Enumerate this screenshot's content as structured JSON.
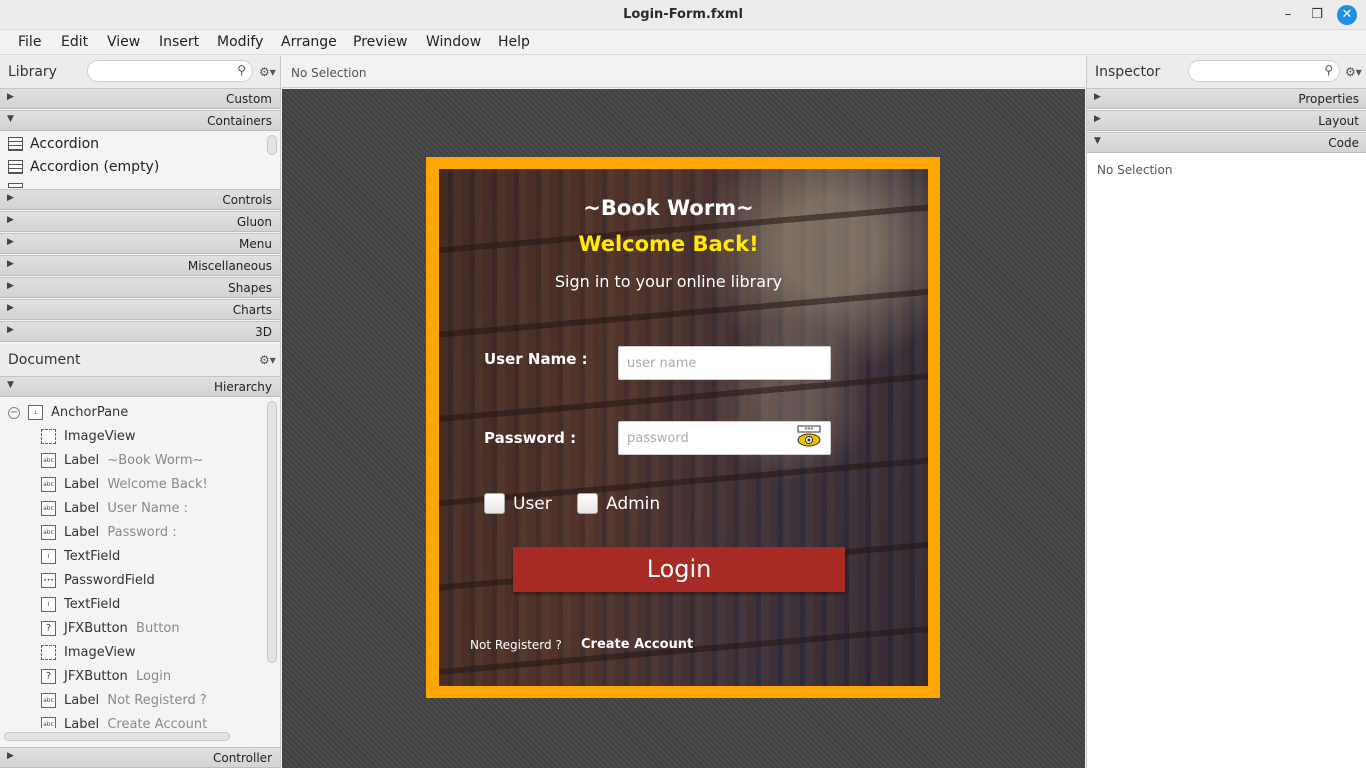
{
  "window": {
    "title": "Login-Form.fxml"
  },
  "menu": [
    "File",
    "Edit",
    "View",
    "Insert",
    "Modify",
    "Arrange",
    "Preview",
    "Window",
    "Help"
  ],
  "library": {
    "title": "Library",
    "sections_top": [
      "Custom",
      "Containers"
    ],
    "containers_items": [
      "Accordion",
      "Accordion  (empty)"
    ],
    "sections_bottom": [
      "Controls",
      "Gluon",
      "Menu",
      "Miscellaneous",
      "Shapes",
      "Charts",
      "3D"
    ]
  },
  "document": {
    "title": "Document",
    "hierarchy_label": "Hierarchy",
    "controller_label": "Controller",
    "tree": [
      {
        "type": "AnchorPane",
        "detail": "",
        "icon": "anchor-icon"
      },
      {
        "type": "ImageView",
        "detail": "",
        "icon": "imageview-icon"
      },
      {
        "type": "Label",
        "detail": "~Book Worm~",
        "icon": "label-icon"
      },
      {
        "type": "Label",
        "detail": "Welcome Back!",
        "icon": "label-icon"
      },
      {
        "type": "Label",
        "detail": "User Name  :",
        "icon": "label-icon"
      },
      {
        "type": "Label",
        "detail": "Password    :",
        "icon": "label-icon"
      },
      {
        "type": "TextField",
        "detail": "",
        "icon": "textfield-icon"
      },
      {
        "type": "PasswordField",
        "detail": "",
        "icon": "passwordfield-icon"
      },
      {
        "type": "TextField",
        "detail": "",
        "icon": "textfield-icon"
      },
      {
        "type": "JFXButton",
        "detail": "Button",
        "icon": "button-icon"
      },
      {
        "type": "ImageView",
        "detail": "",
        "icon": "imageview-icon"
      },
      {
        "type": "JFXButton",
        "detail": "Login",
        "icon": "button-icon"
      },
      {
        "type": "Label",
        "detail": "Not Registerd ?",
        "icon": "label-icon"
      },
      {
        "type": "Label",
        "detail": "Create Account",
        "icon": "label-icon"
      }
    ]
  },
  "editor": {
    "selection": "No Selection"
  },
  "form": {
    "app_title": "~Book Worm~",
    "welcome": "Welcome Back!",
    "subtitle": "Sign in to your online library",
    "username_label": "User Name   :",
    "username_placeholder": "user name",
    "password_label": "Password    :",
    "password_placeholder": "password",
    "role_user": "User",
    "role_admin": "Admin",
    "login_label": "Login",
    "not_registered": "Not Registerd ?",
    "create_account": "Create Account",
    "colors": {
      "frame": "#ffa600",
      "welcome": "#ffea00",
      "login_button": "#a72a24"
    }
  },
  "inspector": {
    "title": "Inspector",
    "sections": [
      "Properties",
      "Layout",
      "Code"
    ],
    "selection": "No Selection"
  }
}
